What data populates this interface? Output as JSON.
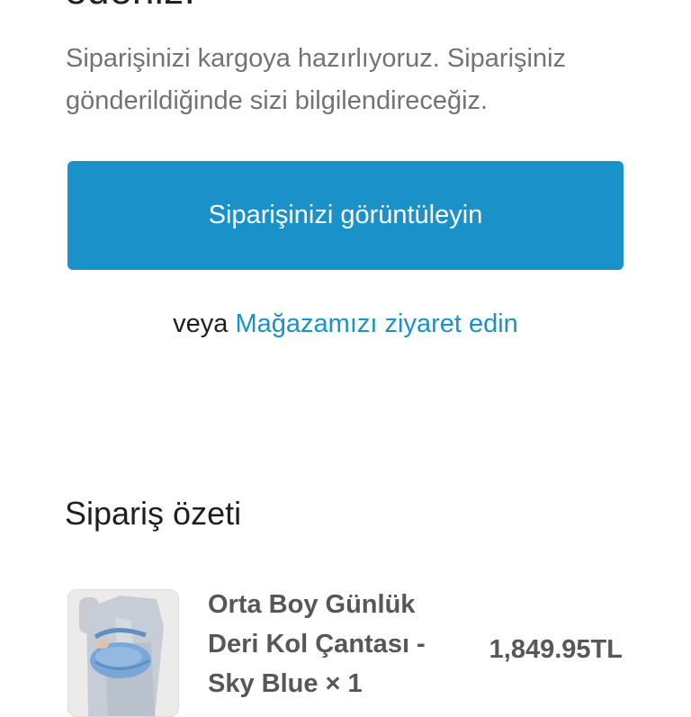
{
  "confirmation": {
    "heading_partial": "edeniz.",
    "description": "Siparişinizi kargoya hazırlıyoruz. Siparişiniz gönderildiğinde sizi bilgilendireceğiz.",
    "view_order_label": "Siparişinizi görüntüleyin",
    "or_label": "veya",
    "visit_store_label": "Mağazamızı ziyaret edin",
    "accent_color": "#1a91c9"
  },
  "summary": {
    "title": "Sipariş özeti",
    "items": [
      {
        "name": "Orta Boy Günlük Deri Kol Çantası - Sky Blue × 1",
        "price": "1,849.95TL",
        "thumbnail_icon": "product-photo-blue-bag"
      }
    ]
  }
}
